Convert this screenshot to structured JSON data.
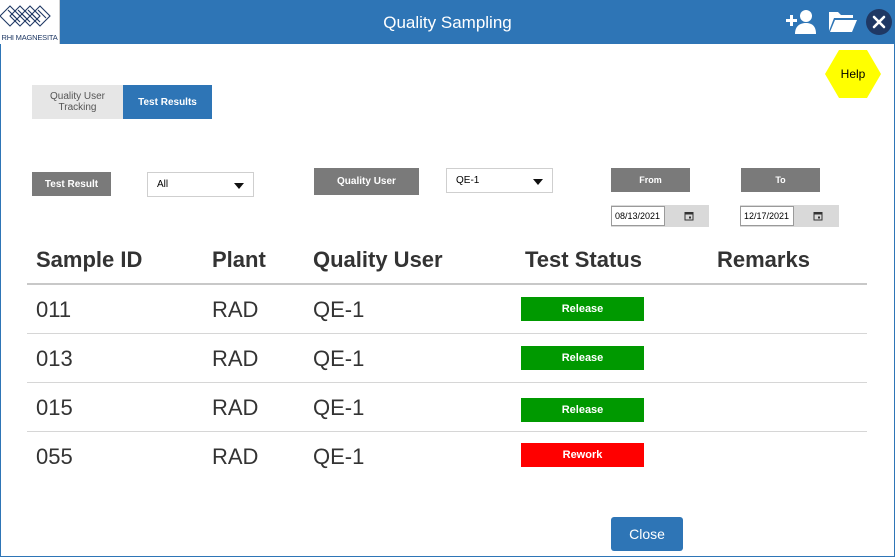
{
  "header": {
    "title": "Quality Sampling",
    "logo_text": "RHI MAGNESITA",
    "icons": [
      "add-user-icon",
      "folder-open-icon",
      "close-icon"
    ]
  },
  "help": {
    "label": "Help"
  },
  "tabs": [
    {
      "label": "Quality User Tracking",
      "active": false
    },
    {
      "label": "Test Results",
      "active": true
    }
  ],
  "filters": {
    "test_result_label": "Test Result",
    "test_result_value": "All",
    "quality_user_label": "Quality User",
    "quality_user_value": "QE-1",
    "from_label": "From",
    "from_value": "08/13/2021",
    "to_label": "To",
    "to_value": "12/17/2021"
  },
  "table": {
    "columns": [
      "Sample ID",
      "Plant",
      "Quality User",
      "Test Status",
      "Remarks"
    ],
    "rows": [
      {
        "sample_id": "011",
        "plant": "RAD",
        "quality_user": "QE-1",
        "status": "Release",
        "remarks": ""
      },
      {
        "sample_id": "013",
        "plant": "RAD",
        "quality_user": "QE-1",
        "status": "Release",
        "remarks": ""
      },
      {
        "sample_id": "015",
        "plant": "RAD",
        "quality_user": "QE-1",
        "status": "Release",
        "remarks": ""
      },
      {
        "sample_id": "055",
        "plant": "RAD",
        "quality_user": "QE-1",
        "status": "Rework",
        "remarks": ""
      }
    ]
  },
  "footer": {
    "close_label": "Close"
  },
  "colors": {
    "header": "#2e75b6",
    "release": "#009900",
    "rework": "#ff0000",
    "help": "#ffff00",
    "label_button": "#7a7a7a"
  }
}
